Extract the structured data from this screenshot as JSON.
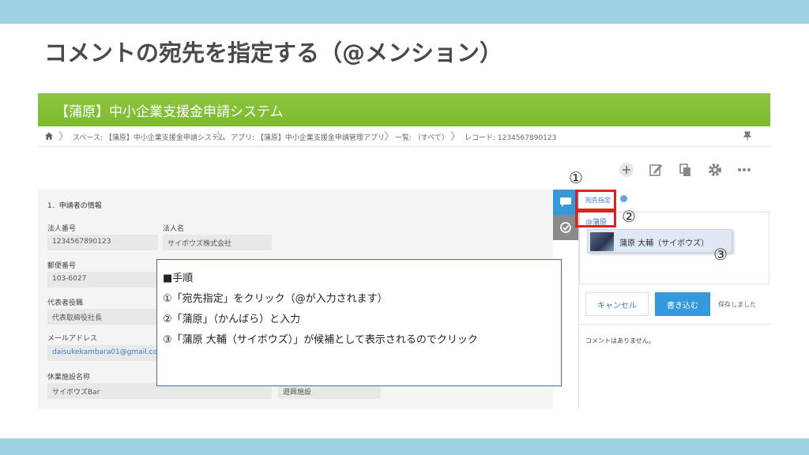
{
  "slide": {
    "title": "コメントの宛先を指定する（@メンション）",
    "band_color": "#9fd3e2"
  },
  "app": {
    "title": "【蒲原】中小企業支援金申請システム",
    "header_color": "#8cc63f",
    "breadcrumb": [
      "スペース: 【蒲原】中小企業支援金申請システム",
      "アプリ: 【蒲原】中小企業支援金申請管理アプリ",
      "一覧: （すべて）",
      "レコード: 1234567890123"
    ],
    "toolbar_icons": [
      "plus-icon",
      "edit-icon",
      "copy-icon",
      "gear-icon",
      "more-icon"
    ]
  },
  "form": {
    "section_title": "1．申請者の情報",
    "fields": {
      "corp_number": {
        "label": "法人番号",
        "value": "1234567890123"
      },
      "corp_name": {
        "label": "法人名",
        "value": "サイボウズ株式会社"
      },
      "postal": {
        "label": "郵便番号",
        "value": "103-6027"
      },
      "rep_title": {
        "label": "代表者役職",
        "value": "代表取締役社長"
      },
      "email": {
        "label": "メールアドレス",
        "value": "daisukekambara01@gmail.co"
      },
      "facility": {
        "label": "休業施設名称",
        "value": "サイボウズBar"
      },
      "facility_type": {
        "value": "遊興施設"
      }
    }
  },
  "comment": {
    "mention_button": "宛先指定",
    "input_text": "@蒲原",
    "suggestion": "蒲原 大輔（サイボウズ）",
    "cancel": "キャンセル",
    "post": "書き込む",
    "saved": "保存しました",
    "empty": "コメントはありません。",
    "accent": "#3498db"
  },
  "markers": {
    "one": "①",
    "two": "②",
    "three": "③",
    "highlight_color": "#e0201b"
  },
  "steps": {
    "heading": "■手順",
    "items": [
      "①「宛先指定」をクリック（@が入力されます）",
      "②「蒲原」（かんばら）と入力",
      "③「蒲原 大輔（サイボウズ）」が候補として表示されるのでクリック"
    ]
  }
}
